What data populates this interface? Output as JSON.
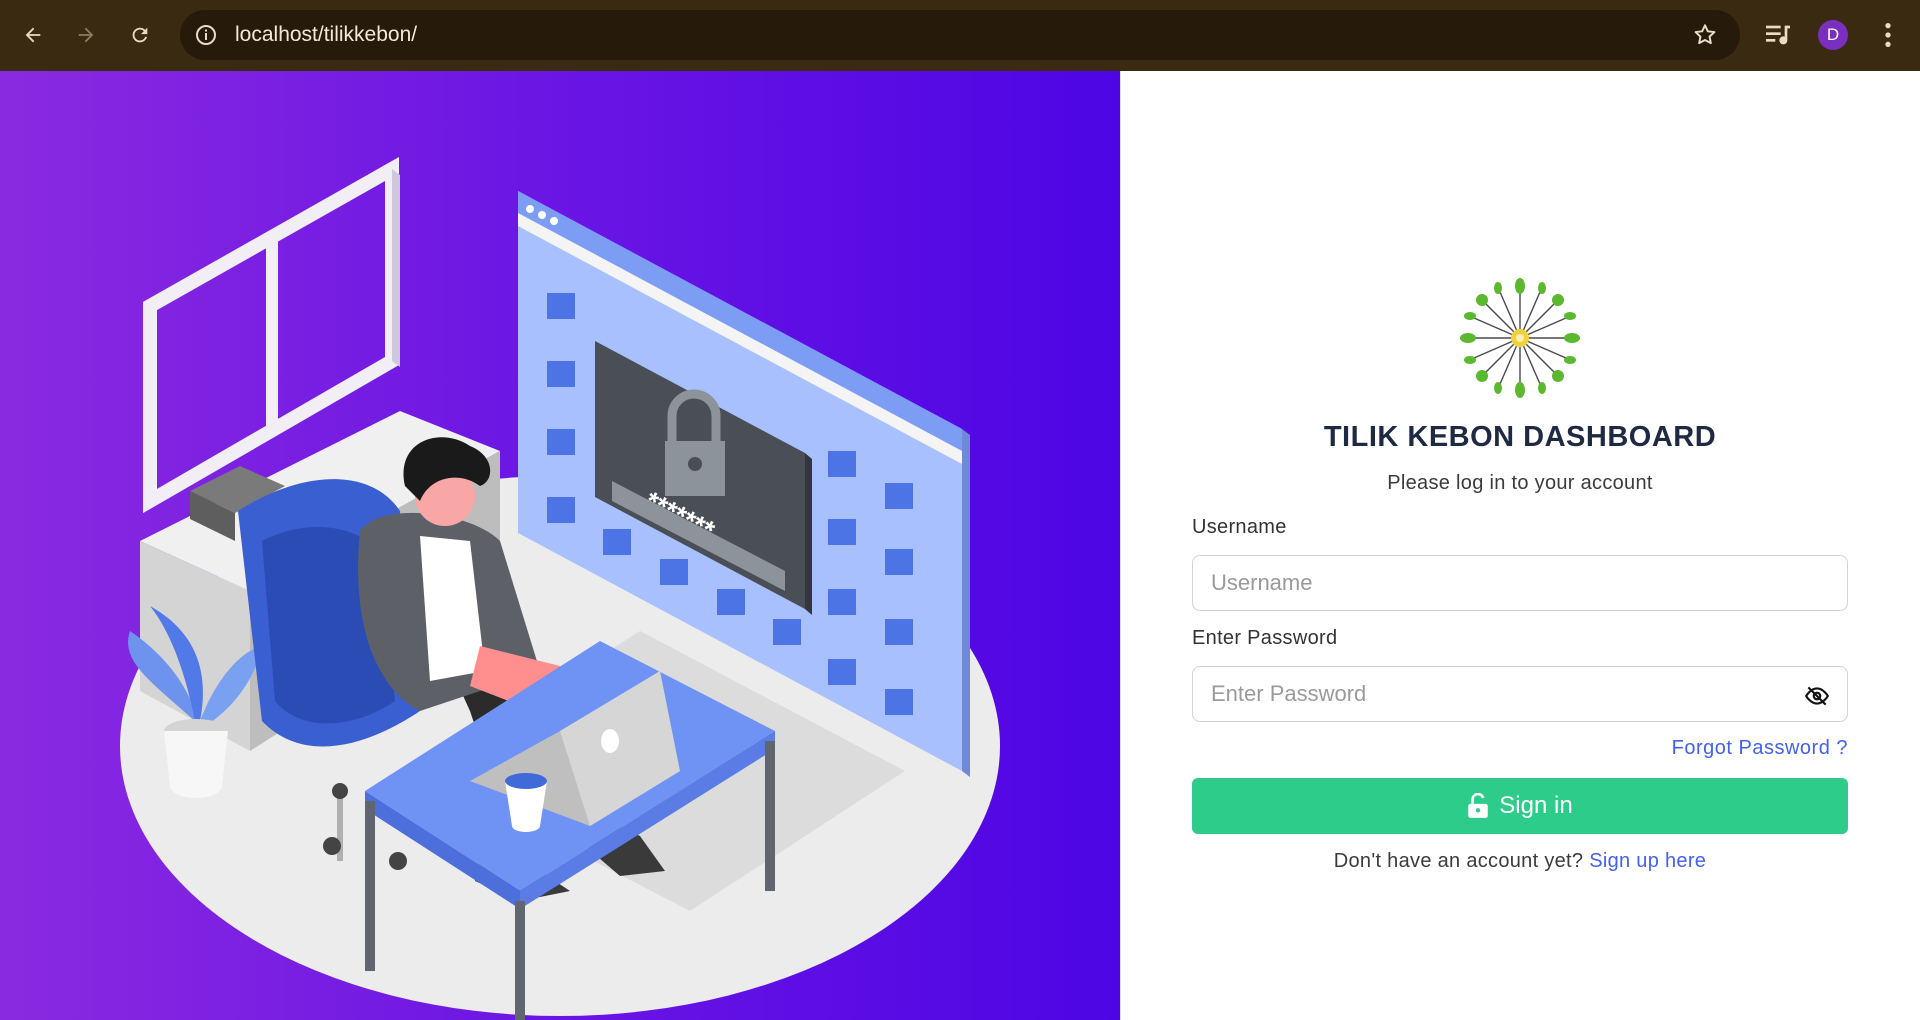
{
  "browser": {
    "url": "localhost/tilikkebon/",
    "profile_initial": "D",
    "icons": [
      "back-arrow-icon",
      "forward-arrow-icon",
      "reload-icon",
      "site-info-icon",
      "bookmark-star-icon",
      "media-queue-icon",
      "kebab-menu-icon"
    ]
  },
  "hero": {
    "illustration": "person-at-desk-with-laptop-and-locked-browser-window",
    "password_mask": "*******",
    "gradient": [
      "#8a2ae0",
      "#4d05e4"
    ]
  },
  "login": {
    "title": "TILIK KEBON DASHBOARD",
    "subtitle": "Please log in to your account",
    "username_label": "Username",
    "username_placeholder": "Username",
    "password_label": "Enter Password",
    "password_placeholder": "Enter Password",
    "forgot_password": "Forgot Password ?",
    "signin_label": "Sign in",
    "signup_prompt": "Don't have an account yet?",
    "signup_link": "Sign up here"
  },
  "colors": {
    "accent_green": "#2ecc8b",
    "link_blue": "#4361ee",
    "title_navy": "#1e2a44",
    "chrome_brown": "#3a2a12"
  }
}
